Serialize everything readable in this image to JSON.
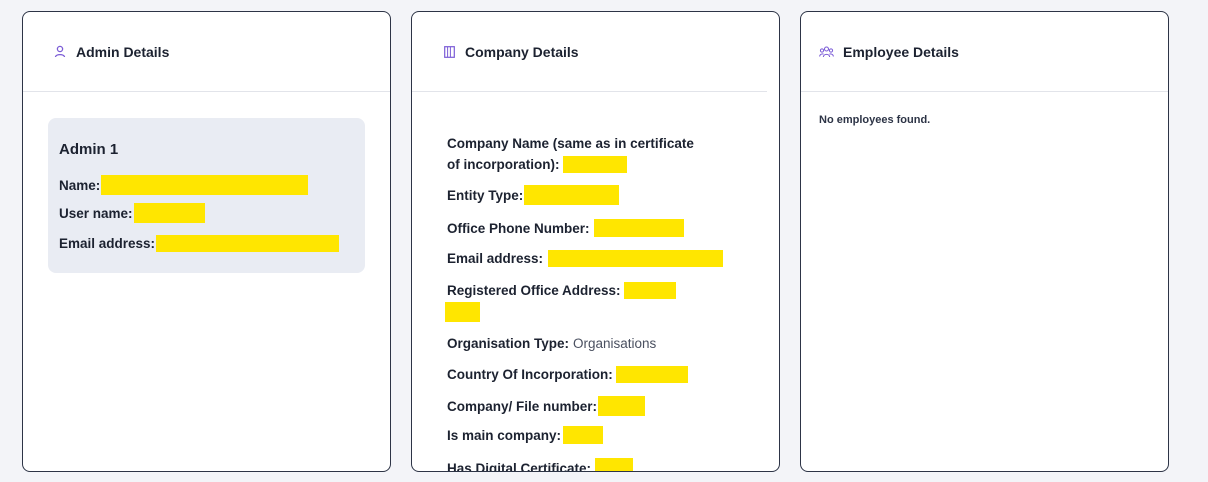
{
  "admin": {
    "title": "Admin Details",
    "heading": "Admin 1",
    "name_label": "Name:",
    "username_label": "User name:",
    "email_label": "Email address:"
  },
  "company": {
    "title": "Company Details",
    "company_name_label_line1": "Company Name (same as in certificate",
    "company_name_label_line2": "of incorporation):",
    "entity_type_label": "Entity Type:",
    "office_phone_label": "Office Phone Number:",
    "email_label": "Email address:",
    "registered_office_label": "Registered Office Address:",
    "org_type_label": "Organisation Type:",
    "org_type_value": "Organisations",
    "country_label": "Country Of Incorporation:",
    "file_number_label": "Company/ File number:",
    "main_company_label": "Is main company:",
    "digital_cert_label": "Has Digital Certificate:"
  },
  "employee": {
    "title": "Employee Details",
    "empty_message": "No employees found."
  },
  "colors": {
    "accent": "#7b5cd6",
    "redaction": "#ffe600",
    "border": "#2d3446"
  },
  "icons": {
    "admin": "user-icon",
    "company": "building-icon",
    "employee": "users-icon"
  }
}
